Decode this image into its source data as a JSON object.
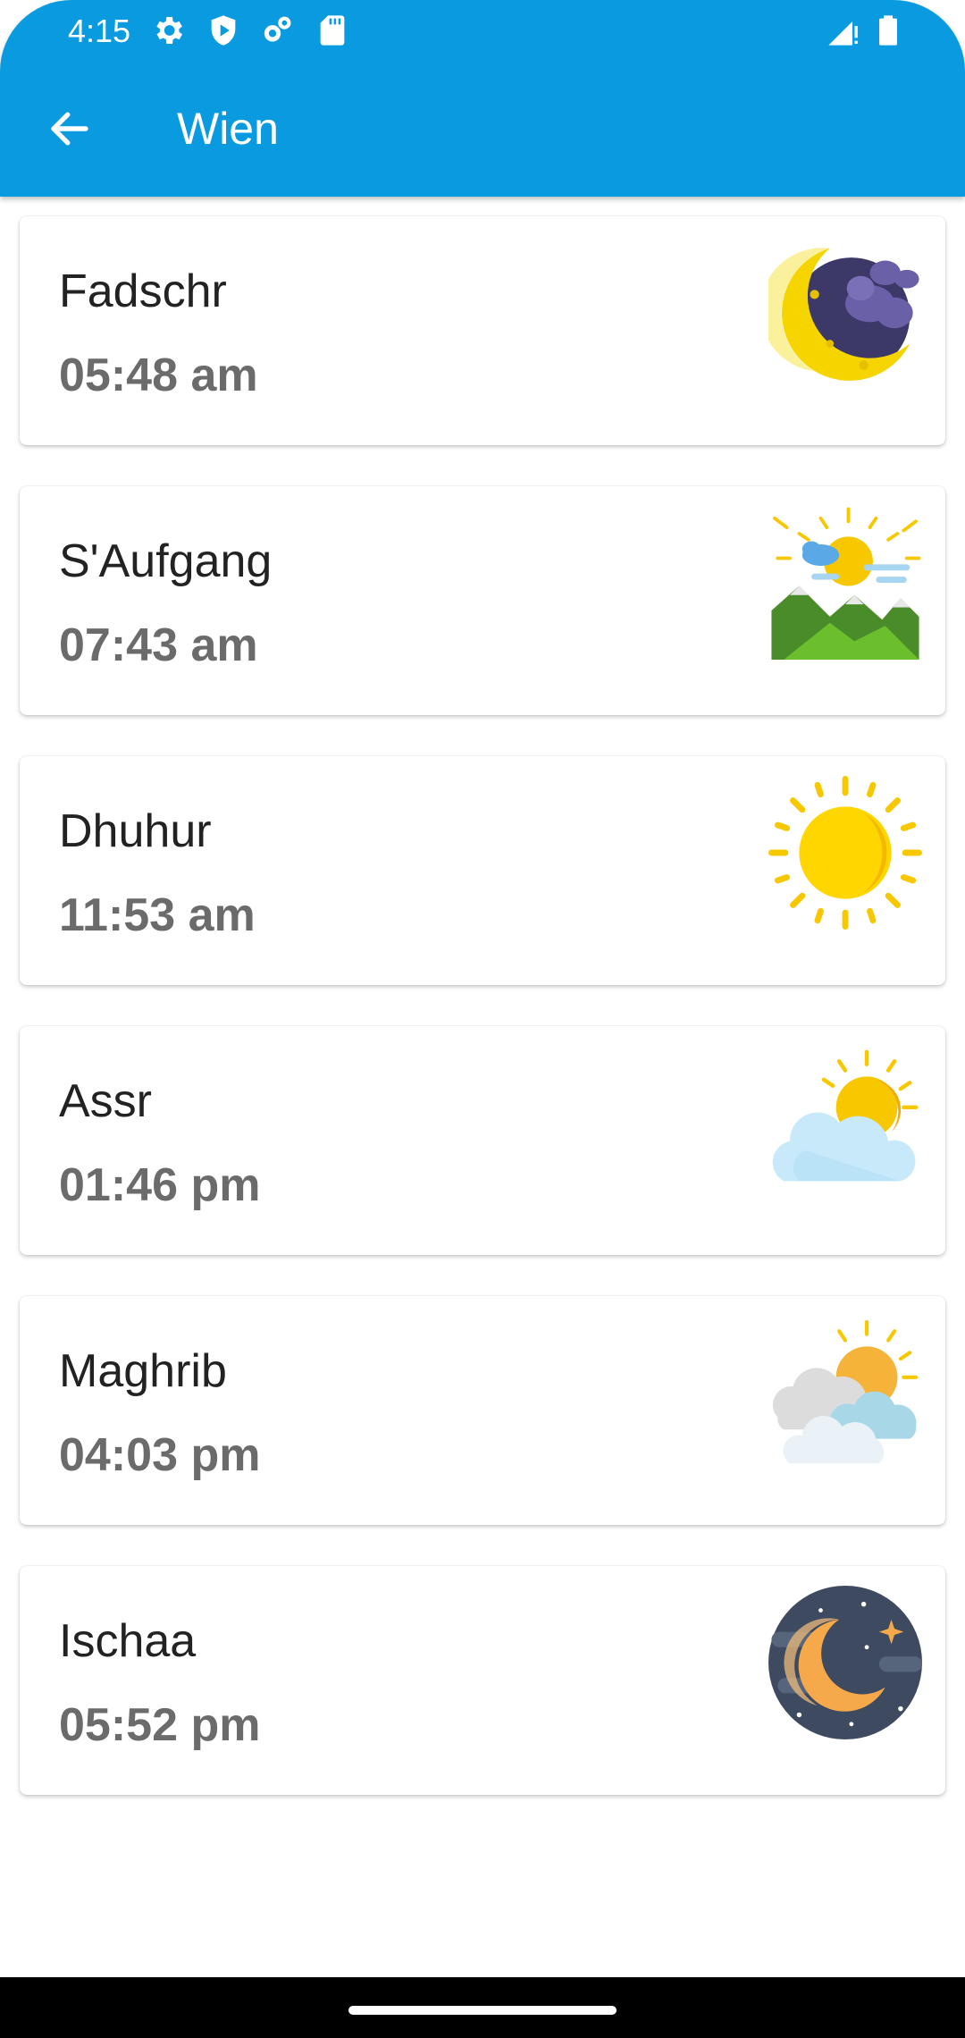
{
  "status_bar": {
    "time": "4:15",
    "icons": [
      "gear-icon",
      "shield-icon",
      "sync-icon",
      "sd-card-icon",
      "signal-icon",
      "battery-icon"
    ]
  },
  "app_bar": {
    "title": "Wien",
    "back_icon": "arrow-back-icon",
    "color": "#0a9ae0"
  },
  "prayers": [
    {
      "name": "Fadschr",
      "time": "05:48 am",
      "icon": "night-crescent-clouds-icon"
    },
    {
      "name": "S'Aufgang",
      "time": "07:43 am",
      "icon": "sunrise-mountains-icon"
    },
    {
      "name": "Dhuhur",
      "time": "11:53 am",
      "icon": "sun-icon"
    },
    {
      "name": "Assr",
      "time": "01:46 pm",
      "icon": "sun-behind-cloud-icon"
    },
    {
      "name": "Maghrib",
      "time": "04:03 pm",
      "icon": "sun-behind-clouds-icon"
    },
    {
      "name": "Ischaa",
      "time": "05:52 pm",
      "icon": "crescent-moon-stars-icon"
    }
  ]
}
